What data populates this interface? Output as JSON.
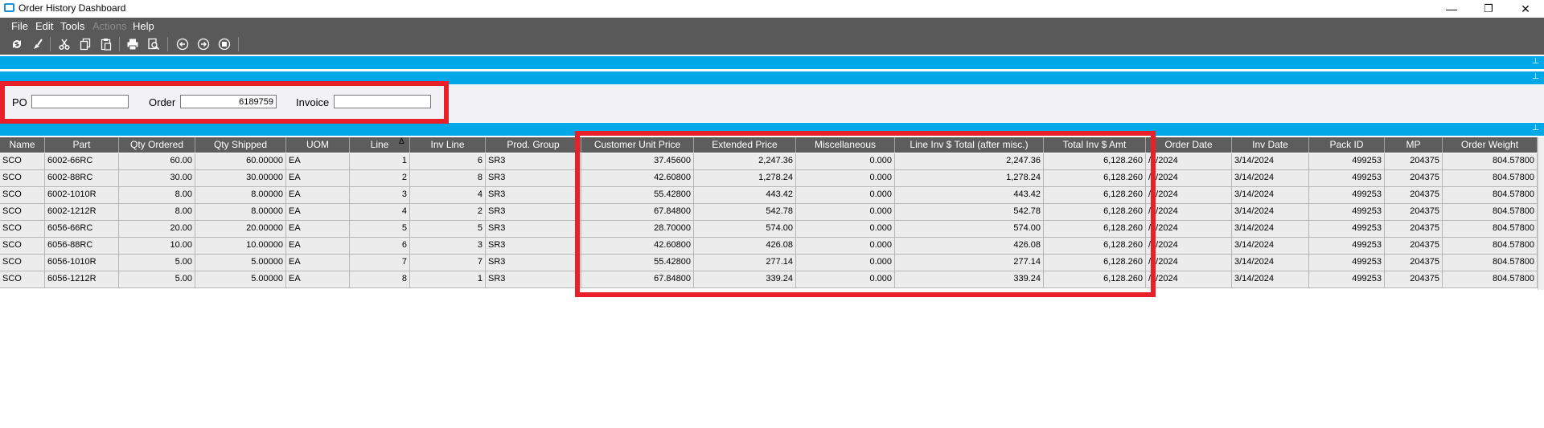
{
  "window": {
    "title": "Order History Dashboard",
    "controls": [
      "—",
      "❐",
      "✕"
    ]
  },
  "menu": [
    "File",
    "Edit",
    "Tools",
    "Actions",
    "Help"
  ],
  "menu_disabled": [
    false,
    false,
    false,
    true,
    false
  ],
  "toolbar": [
    "refresh-icon",
    "clear-icon",
    "cut-icon",
    "copy-icon",
    "paste-icon",
    "print-icon",
    "print-preview-icon",
    "back-icon",
    "forward-icon",
    "home-icon"
  ],
  "filters": {
    "po_label": "PO",
    "po_value": "",
    "order_label": "Order",
    "order_value": "6189759",
    "invoice_label": "Invoice",
    "invoice_value": ""
  },
  "pin_glyph": "⊥",
  "columns": [
    "Name",
    "Part",
    "Qty Ordered",
    "Qty Shipped",
    "UOM",
    "Line",
    "Inv Line",
    "Prod. Group",
    "Customer Unit Price",
    "Extended Price",
    "Miscellaneous",
    "Line Inv $ Total (after misc.)",
    "Total Inv $ Amt",
    "Order Date",
    "Inv Date",
    "Pack ID",
    "MP",
    "Order Weight"
  ],
  "sort_indicator": "Δ",
  "rows": [
    [
      "SCO",
      "6002-66RC",
      "60.00",
      "60.00000",
      "EA",
      "1",
      "6",
      "SR3",
      "37.45600",
      "2,247.36",
      "0.000",
      "2,247.36",
      "6,128.260",
      "/4/2024",
      "3/14/2024",
      "499253",
      "204375",
      "804.57800"
    ],
    [
      "SCO",
      "6002-88RC",
      "30.00",
      "30.00000",
      "EA",
      "2",
      "8",
      "SR3",
      "42.60800",
      "1,278.24",
      "0.000",
      "1,278.24",
      "6,128.260",
      "/4/2024",
      "3/14/2024",
      "499253",
      "204375",
      "804.57800"
    ],
    [
      "SCO",
      "6002-1010R",
      "8.00",
      "8.00000",
      "EA",
      "3",
      "4",
      "SR3",
      "55.42800",
      "443.42",
      "0.000",
      "443.42",
      "6,128.260",
      "/4/2024",
      "3/14/2024",
      "499253",
      "204375",
      "804.57800"
    ],
    [
      "SCO",
      "6002-1212R",
      "8.00",
      "8.00000",
      "EA",
      "4",
      "2",
      "SR3",
      "67.84800",
      "542.78",
      "0.000",
      "542.78",
      "6,128.260",
      "/4/2024",
      "3/14/2024",
      "499253",
      "204375",
      "804.57800"
    ],
    [
      "SCO",
      "6056-66RC",
      "20.00",
      "20.00000",
      "EA",
      "5",
      "5",
      "SR3",
      "28.70000",
      "574.00",
      "0.000",
      "574.00",
      "6,128.260",
      "/4/2024",
      "3/14/2024",
      "499253",
      "204375",
      "804.57800"
    ],
    [
      "SCO",
      "6056-88RC",
      "10.00",
      "10.00000",
      "EA",
      "6",
      "3",
      "SR3",
      "42.60800",
      "426.08",
      "0.000",
      "426.08",
      "6,128.260",
      "/4/2024",
      "3/14/2024",
      "499253",
      "204375",
      "804.57800"
    ],
    [
      "SCO",
      "6056-1010R",
      "5.00",
      "5.00000",
      "EA",
      "7",
      "7",
      "SR3",
      "55.42800",
      "277.14",
      "0.000",
      "277.14",
      "6,128.260",
      "/4/2024",
      "3/14/2024",
      "499253",
      "204375",
      "804.57800"
    ],
    [
      "SCO",
      "6056-1212R",
      "5.00",
      "5.00000",
      "EA",
      "8",
      "1",
      "SR3",
      "67.84800",
      "339.24",
      "0.000",
      "339.24",
      "6,128.260",
      "/4/2024",
      "3/14/2024",
      "499253",
      "204375",
      "804.57800"
    ]
  ]
}
